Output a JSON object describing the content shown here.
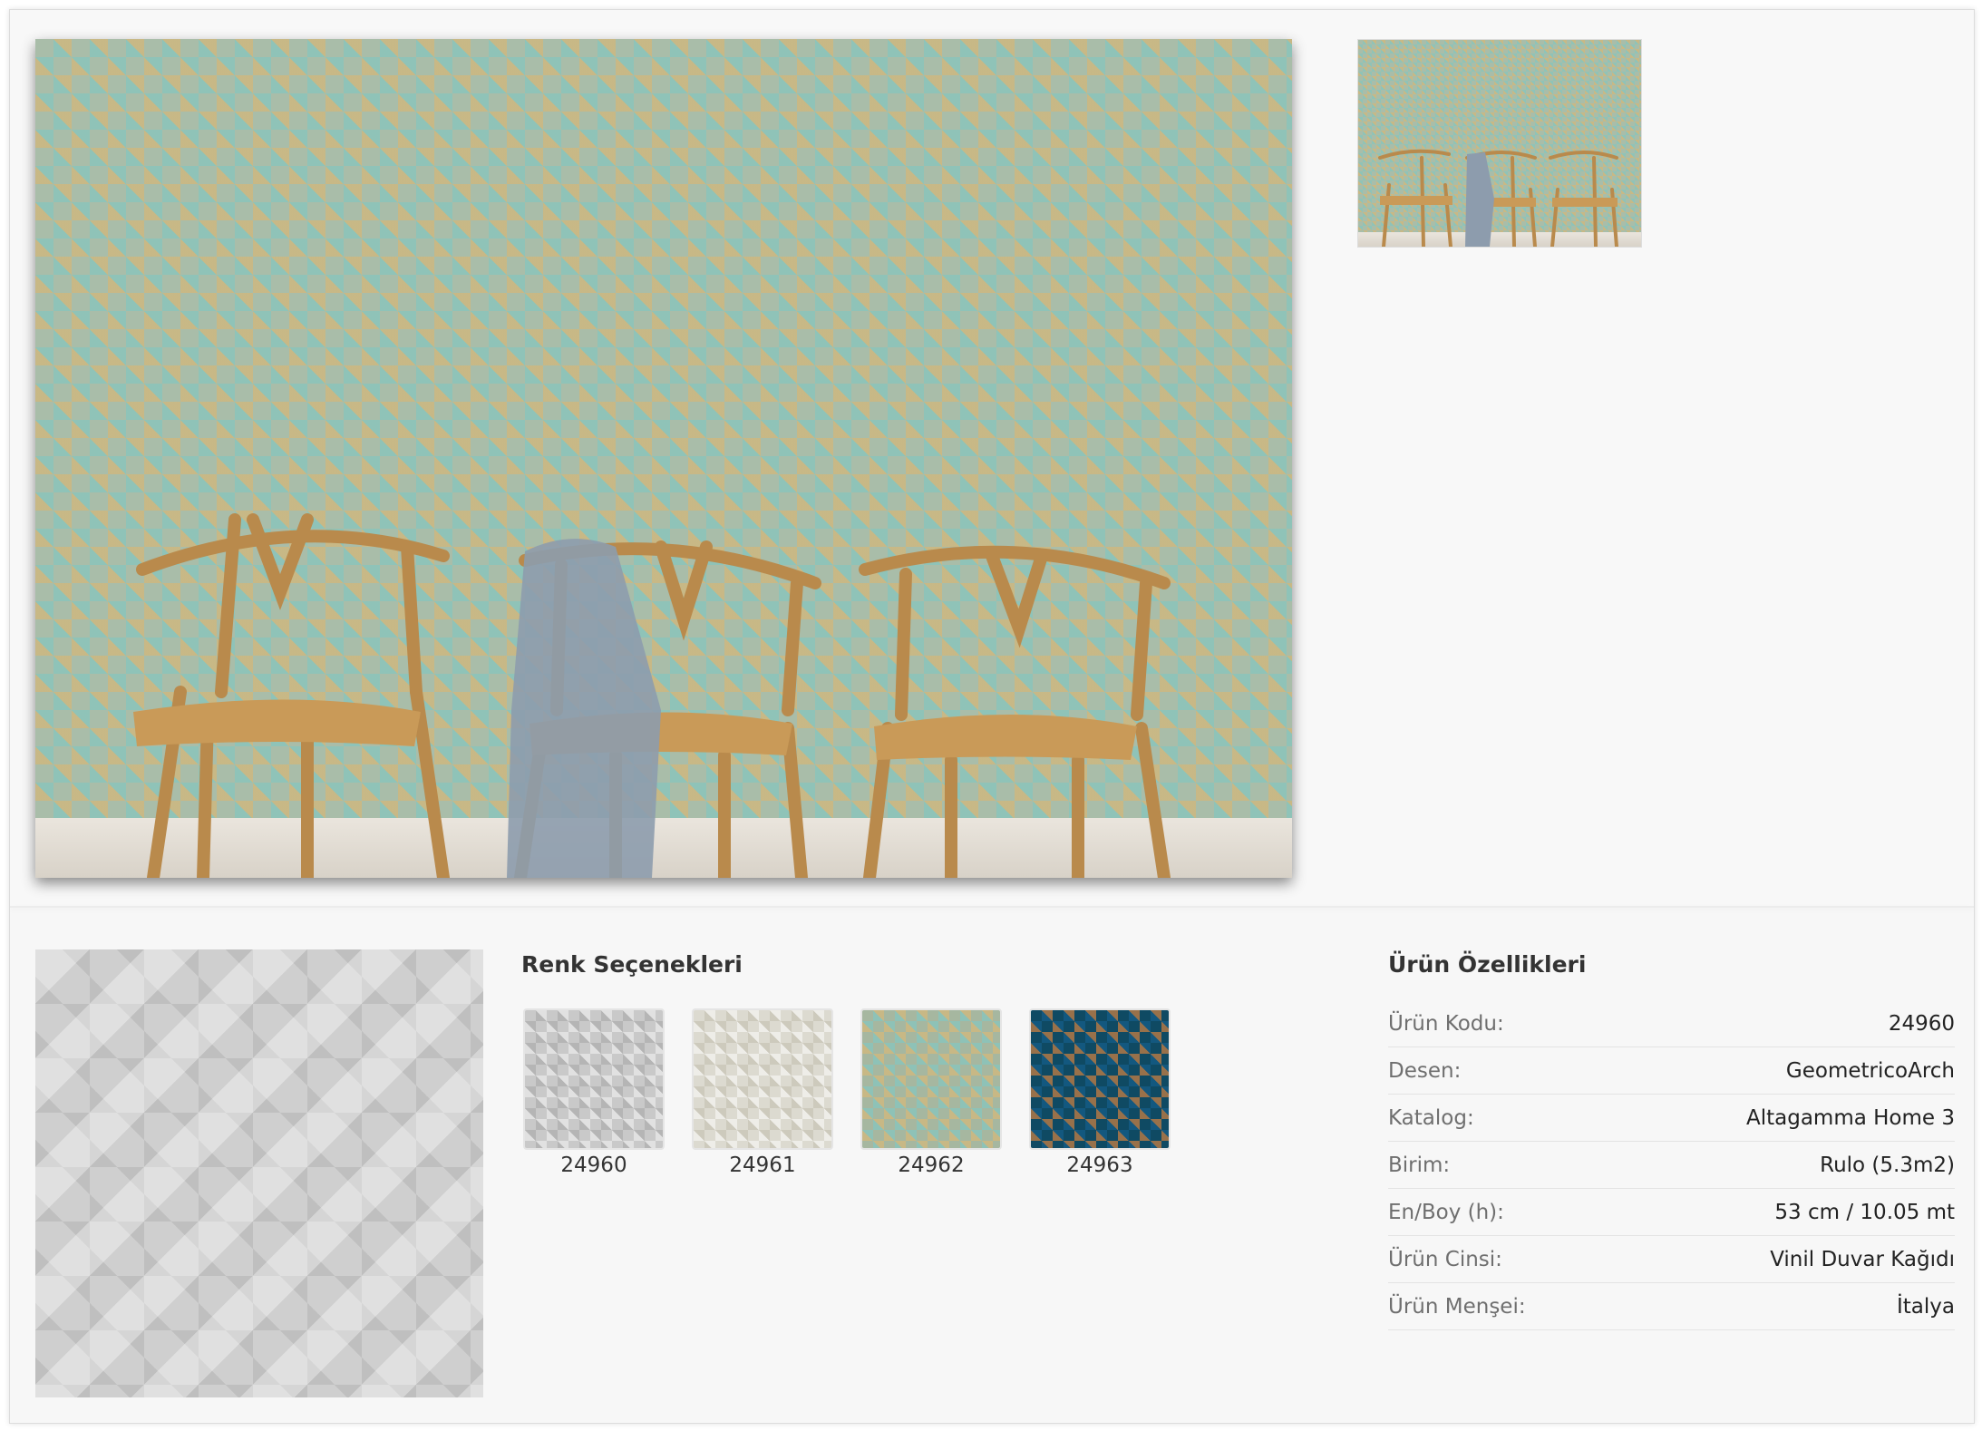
{
  "gallery": {
    "main_image_label": "",
    "thumbnail_label": ""
  },
  "colors": {
    "title": "Renk Seçenekleri",
    "options": [
      {
        "code": "24960",
        "swatch_color": "#c9c9c9"
      },
      {
        "code": "24961",
        "swatch_color": "#dcdad0"
      },
      {
        "code": "24962",
        "swatch_color": "#a6b7a0"
      },
      {
        "code": "24963",
        "swatch_color": "#0f4a63"
      }
    ]
  },
  "properties": {
    "title": "Ürün Özellikleri",
    "rows": [
      {
        "key": "Ürün Kodu:",
        "value": "24960"
      },
      {
        "key": "Desen:",
        "value": "GeometricoArch"
      },
      {
        "key": "Katalog:",
        "value": "Altagamma Home 3"
      },
      {
        "key": "Birim:",
        "value": "Rulo (5.3m2)"
      },
      {
        "key": "En/Boy (h):",
        "value": "53 cm / 10.05 mt"
      },
      {
        "key": "Ürün Cinsi:",
        "value": "Vinil Duvar Kağıdı"
      },
      {
        "key": "Ürün Menşei:",
        "value": "İtalya"
      }
    ]
  },
  "theme": {
    "page_bg": "#f7f7f7",
    "text": "#333333",
    "muted": "#6f6f6f"
  }
}
